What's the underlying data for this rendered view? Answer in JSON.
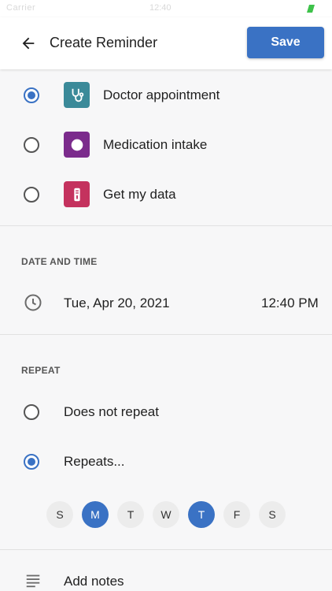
{
  "status_bar": {
    "carrier": "Carrier",
    "time": "12:40",
    "battery_color": "#3ec24a"
  },
  "header": {
    "title": "Create Reminder",
    "save_label": "Save"
  },
  "reminder_types": [
    {
      "label": "Doctor appointment",
      "selected": true,
      "icon": "stethoscope-icon",
      "color": "#3b8a99"
    },
    {
      "label": "Medication intake",
      "selected": false,
      "icon": "pill-icon",
      "color": "#7b2b8c"
    },
    {
      "label": "Get my data",
      "selected": false,
      "icon": "device-icon",
      "color": "#c4325e"
    }
  ],
  "date_time": {
    "header": "DATE AND TIME",
    "date": "Tue, Apr 20, 2021",
    "time": "12:40 PM"
  },
  "repeat": {
    "header": "REPEAT",
    "options": [
      {
        "label": "Does not repeat",
        "selected": false
      },
      {
        "label": "Repeats...",
        "selected": true
      }
    ],
    "days": [
      {
        "label": "S",
        "selected": false
      },
      {
        "label": "M",
        "selected": true
      },
      {
        "label": "T",
        "selected": false
      },
      {
        "label": "W",
        "selected": false
      },
      {
        "label": "T",
        "selected": true
      },
      {
        "label": "F",
        "selected": false
      },
      {
        "label": "S",
        "selected": false
      }
    ]
  },
  "notes": {
    "label": "Add notes"
  },
  "colors": {
    "accent": "#3a72c4"
  }
}
